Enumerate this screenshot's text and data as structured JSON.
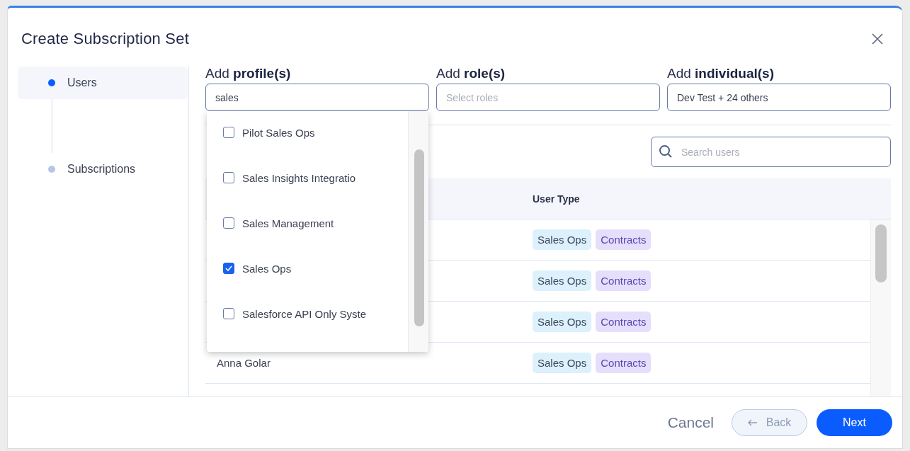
{
  "dialog": {
    "title": "Create Subscription Set"
  },
  "steps": [
    {
      "label": "Users",
      "selected": true
    },
    {
      "label": "Subscriptions",
      "selected": false
    }
  ],
  "filters": [
    {
      "label": "Add **profile(s)**",
      "value": "sales"
    },
    {
      "label": "Add **role(s)**",
      "placeholder": "Select roles"
    },
    {
      "label": "Add **individual(s)**",
      "value": "Dev Test + 24 others"
    }
  ],
  "profile_options": [
    {
      "label": "Pilot Sales Ops",
      "checked": false
    },
    {
      "label": "Sales Insights Integratio",
      "checked": false
    },
    {
      "label": "Sales Management",
      "checked": false
    },
    {
      "label": "Sales Ops",
      "checked": true
    },
    {
      "label": "Salesforce API Only Syste",
      "checked": false
    }
  ],
  "search": {
    "placeholder": "Search users"
  },
  "table": {
    "columns": [
      "User Type"
    ],
    "rows": [
      {
        "tags": [
          {
            "label": "Sales Ops",
            "color": "#dcf1fb"
          },
          {
            "label": "Contracts",
            "color": "#e6dffc"
          }
        ]
      },
      {
        "tags": [
          {
            "label": "Sales Ops",
            "color": "#dcf1fb"
          },
          {
            "label": "Contracts",
            "color": "#e6dffc"
          }
        ]
      },
      {
        "tags": [
          {
            "label": "Sales Ops",
            "color": "#dcf1fb"
          },
          {
            "label": "Contracts",
            "color": "#e6dffc"
          }
        ]
      },
      {
        "name": "Anna Golar",
        "tags": [
          {
            "label": "Sales Ops",
            "color": "#dcf1fb"
          },
          {
            "label": "Contracts",
            "color": "#e6dffc"
          }
        ]
      }
    ]
  },
  "buttons": [
    {
      "label": "Cancel",
      "kind": "text",
      "disabled": false
    },
    {
      "label": "Back",
      "kind": "back",
      "disabled": true
    },
    {
      "label": "Next",
      "kind": "primary",
      "disabled": false
    }
  ]
}
